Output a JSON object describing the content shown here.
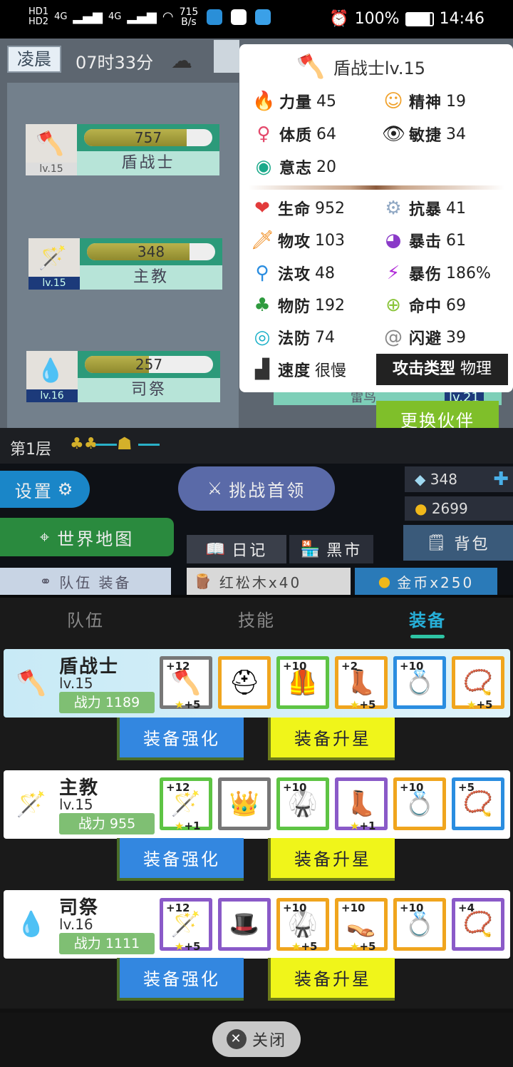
{
  "status_bar": {
    "net_labels": [
      "HD1",
      "HD2",
      "4G",
      "4G"
    ],
    "speed": "715",
    "speed_unit": "B/s",
    "battery": "100%",
    "time": "14:46"
  },
  "game": {
    "period": "凌晨",
    "clock": "07时33分",
    "cards": [
      {
        "hp": "757",
        "hp_pct": 80,
        "name": "盾战士",
        "lv": "lv.15",
        "icon": "🪓"
      },
      {
        "hp": "348",
        "hp_pct": 80,
        "name": "主教",
        "lv": "lv.15",
        "icon": "🪄"
      },
      {
        "hp": "257",
        "hp_pct": 50,
        "name": "司祭",
        "lv": "lv.16",
        "icon": "💧"
      }
    ],
    "hidden_name": "雷鸟",
    "hidden_lv": "lv.21",
    "swap_label": "更换伙伴",
    "floor": "第1层"
  },
  "stat_popup": {
    "title": "盾战士lv.15",
    "attributes": [
      {
        "label": "力量",
        "value": "45",
        "icon": "fire-icon"
      },
      {
        "label": "精神",
        "value": "19",
        "icon": "head-icon"
      },
      {
        "label": "体质",
        "value": "64",
        "icon": "body-icon"
      },
      {
        "label": "敏捷",
        "value": "34",
        "icon": "eye-icon"
      },
      {
        "label": "意志",
        "value": "20",
        "icon": "will-icon"
      }
    ],
    "combat": [
      {
        "label": "生命",
        "value": "952"
      },
      {
        "label": "抗暴",
        "value": "41"
      },
      {
        "label": "物攻",
        "value": "103"
      },
      {
        "label": "暴击",
        "value": "61"
      },
      {
        "label": "法攻",
        "value": "48"
      },
      {
        "label": "暴伤",
        "value": "186%"
      },
      {
        "label": "物防",
        "value": "192"
      },
      {
        "label": "命中",
        "value": "69"
      },
      {
        "label": "法防",
        "value": "74"
      },
      {
        "label": "闪避",
        "value": "39"
      },
      {
        "label": "速度",
        "value": "很慢"
      }
    ],
    "attack_type_label": "攻击类型",
    "attack_type_value": "物理"
  },
  "lower": {
    "settings": "设置",
    "challenge": "挑战首领",
    "diamonds": "348",
    "coins": "2699",
    "world_map": "世界地图",
    "diary": "日记",
    "market": "黑市",
    "bag": "背包",
    "item1": "红松木x40",
    "item2": "金币x250",
    "team_equip": "队伍  装备"
  },
  "tabs": [
    "队伍",
    "技能",
    "装备"
  ],
  "members": [
    {
      "name": "盾战士",
      "lv": "lv.15",
      "power_label": "战力",
      "power": "1189",
      "slots": [
        {
          "plus": "+12",
          "star": "+5",
          "icon": "axe-icon",
          "glyph": "🪓"
        },
        {
          "plus": "",
          "star": "",
          "icon": "helmet-icon",
          "glyph": "⛑"
        },
        {
          "plus": "+10",
          "star": "",
          "icon": "armor-icon",
          "glyph": "🦺"
        },
        {
          "plus": "+2",
          "star": "+5",
          "icon": "boots-icon",
          "glyph": "👢"
        },
        {
          "plus": "+10",
          "star": "",
          "icon": "ring-icon",
          "glyph": "💍"
        },
        {
          "plus": "",
          "star": "+5",
          "icon": "necklace-icon",
          "glyph": "📿"
        }
      ]
    },
    {
      "name": "主教",
      "lv": "lv.15",
      "power_label": "战力",
      "power": "955",
      "slots": [
        {
          "plus": "+12",
          "star": "+1",
          "icon": "staff-icon",
          "glyph": "🪄"
        },
        {
          "plus": "",
          "star": "",
          "icon": "crown-icon",
          "glyph": "👑"
        },
        {
          "plus": "+10",
          "star": "",
          "icon": "robe-icon",
          "glyph": "🥋"
        },
        {
          "plus": "",
          "star": "+1",
          "icon": "boots-icon",
          "glyph": "👢"
        },
        {
          "plus": "+10",
          "star": "",
          "icon": "ring-icon",
          "glyph": "💍"
        },
        {
          "plus": "+5",
          "star": "",
          "icon": "necklace-icon",
          "glyph": "📿"
        }
      ]
    },
    {
      "name": "司祭",
      "lv": "lv.16",
      "power_label": "战力",
      "power": "1111",
      "slots": [
        {
          "plus": "+12",
          "star": "+5",
          "icon": "wand-icon",
          "glyph": "🪄"
        },
        {
          "plus": "",
          "star": "",
          "icon": "hat-icon",
          "glyph": "🎩"
        },
        {
          "plus": "+10",
          "star": "+5",
          "icon": "robe-icon",
          "glyph": "🥋"
        },
        {
          "plus": "+10",
          "star": "+5",
          "icon": "sandals-icon",
          "glyph": "👡"
        },
        {
          "plus": "+10",
          "star": "",
          "icon": "ring-icon",
          "glyph": "💍"
        },
        {
          "plus": "+4",
          "star": "",
          "icon": "necklace-icon",
          "glyph": "📿"
        }
      ]
    }
  ],
  "enhance_label": "装备强化",
  "starup_label": "装备升星",
  "close_label": "关闭"
}
